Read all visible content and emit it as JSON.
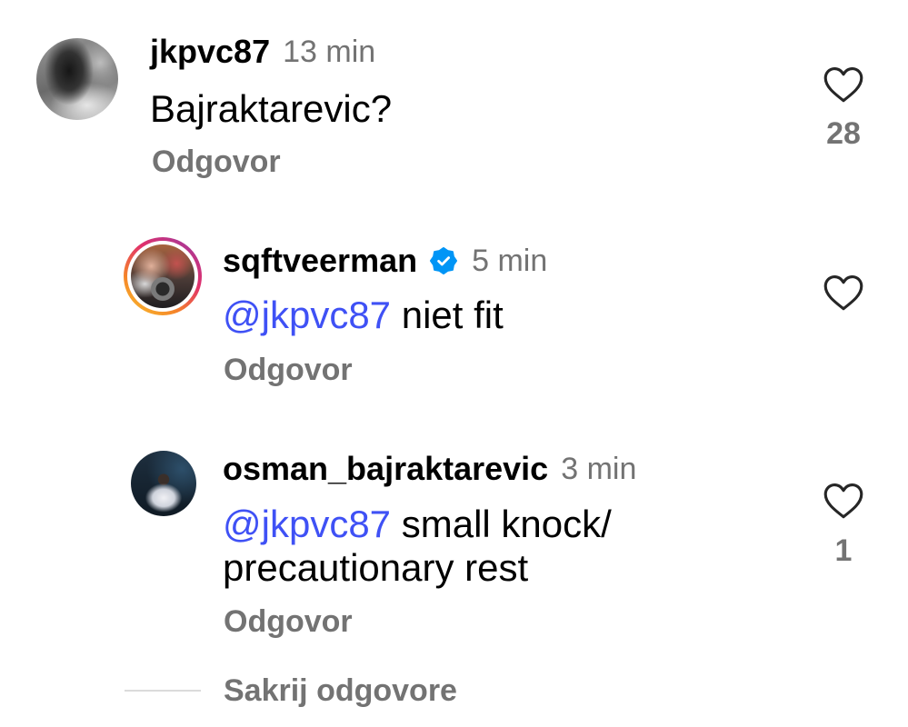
{
  "colors": {
    "text": "#000000",
    "secondary": "#737373",
    "mention": "#3F51F5",
    "verified": "#0095F6",
    "icon": "#262626"
  },
  "icons": {
    "like": "heart-icon",
    "verified": "verified-badge-icon"
  },
  "comment": {
    "username": "jkpvc87",
    "time": "13 min",
    "text": "Bajraktarevic?",
    "reply_label": "Odgovor",
    "likes": "28"
  },
  "replies": [
    {
      "username": "sqftveerman",
      "verified": true,
      "time": "5 min",
      "mention": "@jkpvc87",
      "text": "niet fit",
      "reply_label": "Odgovor"
    },
    {
      "username": "osman_bajraktarevic",
      "verified": false,
      "time": "3 min",
      "mention": "@jkpvc87",
      "text": "small knock/ precautionary rest",
      "reply_label": "Odgovor",
      "likes": "1"
    }
  ],
  "hide_replies_label": "Sakrij odgovore"
}
